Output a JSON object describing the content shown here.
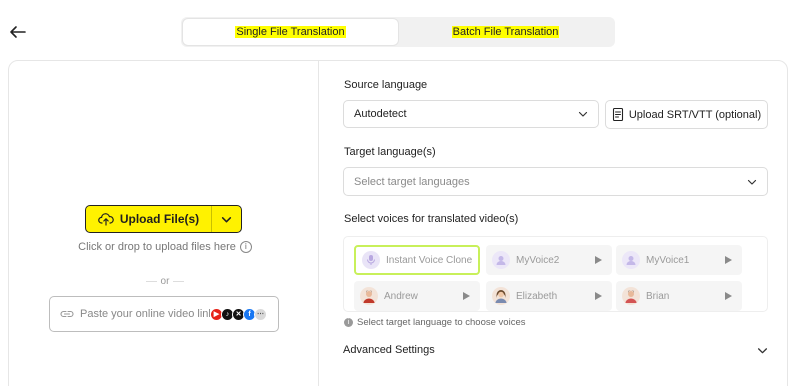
{
  "tabs": [
    {
      "label": "Single File Translation",
      "active": true
    },
    {
      "label": "Batch File Translation",
      "active": false
    }
  ],
  "upload": {
    "button_label": "Upload File(s)",
    "hint": "Click or drop to upload files here",
    "or": "or",
    "link_placeholder": "Paste your online video link"
  },
  "source": {
    "label": "Source language",
    "value": "Autodetect",
    "srt_label": "Upload SRT/VTT (optional)"
  },
  "target": {
    "label": "Target language(s)",
    "placeholder": "Select target languages"
  },
  "voices": {
    "label": "Select voices for translated video(s)",
    "items": [
      {
        "name": "Instant Voice Clone",
        "selected": true
      },
      {
        "name": "MyVoice2",
        "selected": false
      },
      {
        "name": "MyVoice1",
        "selected": false
      },
      {
        "name": "Andrew",
        "selected": false
      },
      {
        "name": "Elizabeth",
        "selected": false
      },
      {
        "name": "Brian",
        "selected": false
      }
    ],
    "hint": "Select target language to choose voices"
  },
  "advanced": {
    "label": "Advanced Settings"
  },
  "colors": {
    "accent": "#fff200",
    "highlight": "#ffff00",
    "selected_border": "#c8f05a"
  }
}
